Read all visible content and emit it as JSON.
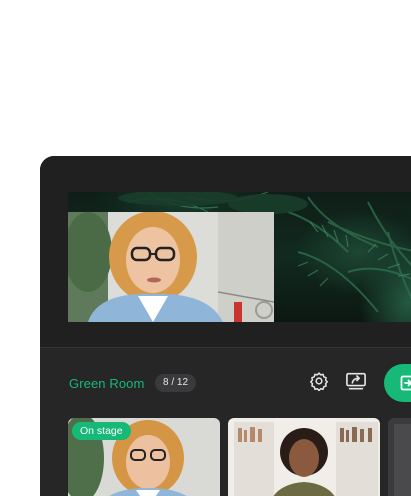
{
  "room": {
    "title": "Green Room",
    "participant_count": "8 / 12"
  },
  "thumbnails": [
    {
      "badge": "On stage"
    },
    {
      "badge": ""
    },
    {
      "badge": ""
    }
  ],
  "icons": {
    "settings": "gear-icon",
    "share": "screen-share-icon",
    "action": "enter-stage-icon"
  },
  "colors": {
    "accent": "#17b978",
    "app_bg": "#1f1f20",
    "panel_bg": "#262627",
    "badge_bg": "#3a3a3c"
  }
}
